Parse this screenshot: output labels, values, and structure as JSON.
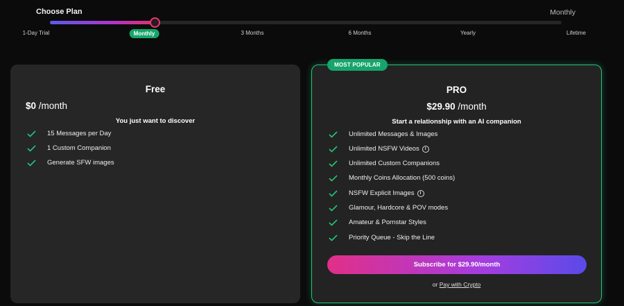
{
  "header": {
    "title": "Choose Plan",
    "selected_label": "Monthly",
    "slider": {
      "stops": [
        "1-Day Trial",
        "Monthly",
        "3 Months",
        "6 Months",
        "Yearly",
        "Lifetime"
      ],
      "active_index": 1
    }
  },
  "plans": {
    "free": {
      "title": "Free",
      "price": "$0",
      "period": "/month",
      "tagline": "You just want to discover",
      "features": [
        "15 Messages per Day",
        "1 Custom Companion",
        "Generate SFW images"
      ]
    },
    "pro": {
      "badge": "MOST POPULAR",
      "title": "PRO",
      "price": "$29.90",
      "period": "/month",
      "tagline": "Start a relationship with an AI companion",
      "features": [
        "Unlimited Messages & Images",
        "Unlimited NSFW Videos",
        "Unlimited Custom Companions",
        "Monthly Coins Allocation (500 coins)",
        "NSFW Explicit Images",
        "Glamour, Hardcore & POV modes",
        "Amateur & Pornstar Styles",
        "Priority Queue - Skip the Line"
      ],
      "subscribe_label": "Subscribe for $29.90/month",
      "crypto_prefix": "or",
      "crypto_link": "Pay with Crypto"
    }
  },
  "colors": {
    "accent_green": "#16a56c",
    "check_green": "#22c57a",
    "slider_pink": "#e43a6e"
  },
  "icons": {
    "feature": "check-icon",
    "info": "info-icon"
  }
}
